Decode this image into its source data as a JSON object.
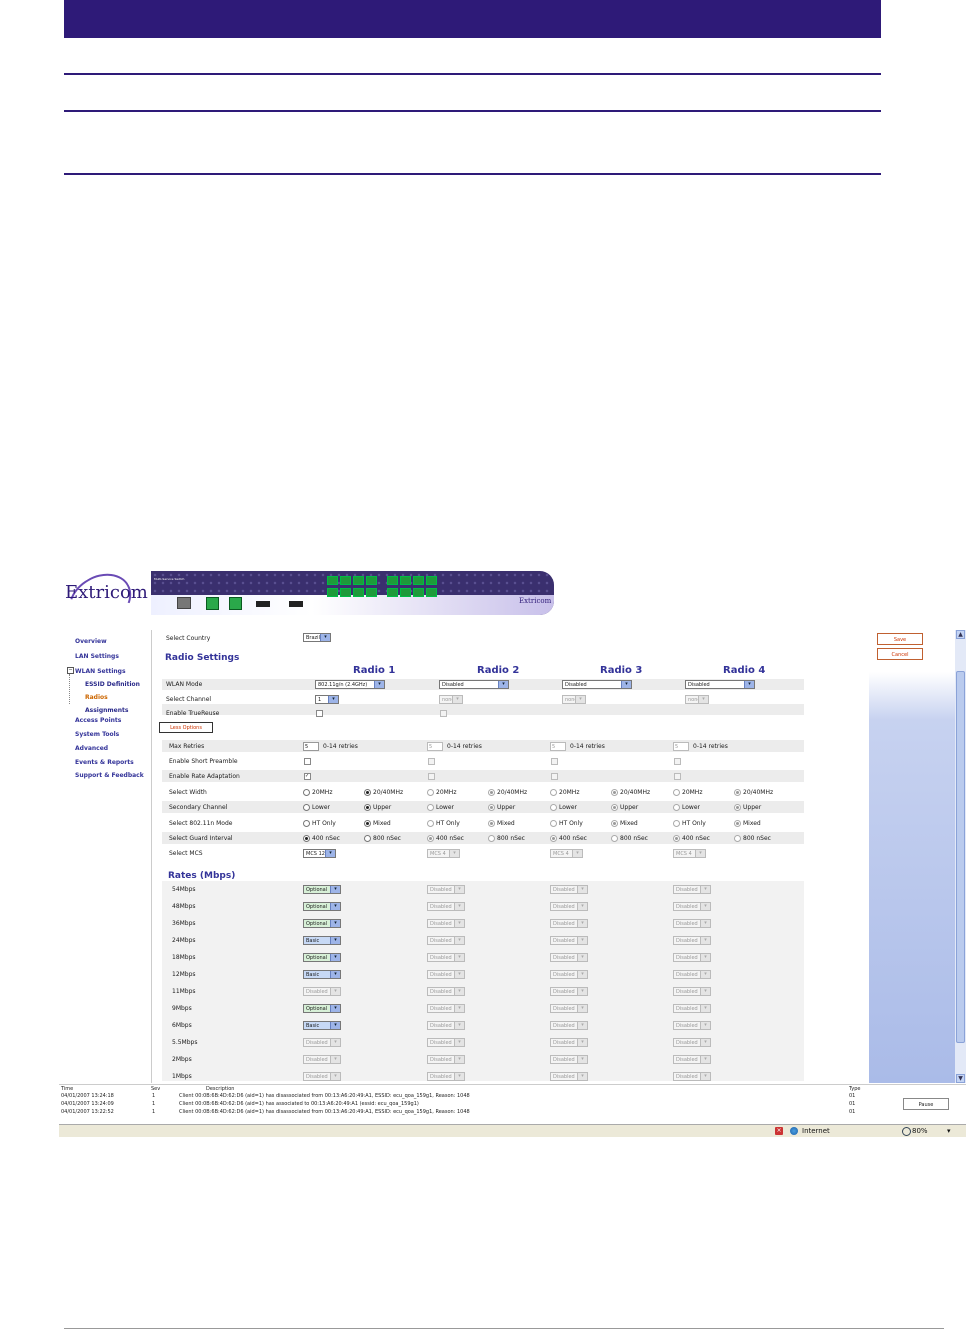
{
  "banner": {},
  "app": {
    "logo": "Extricom",
    "device_logo": "Extricom",
    "device_model_label": "Multi-Service Switch"
  },
  "nav": [
    {
      "label": "Overview"
    },
    {
      "label": "LAN Settings"
    },
    {
      "label": "WLAN Settings"
    },
    {
      "label": "ESSID Definition"
    },
    {
      "label": "Radios"
    },
    {
      "label": "Assignments"
    },
    {
      "label": "Access Points"
    },
    {
      "label": "System Tools"
    },
    {
      "label": "Advanced"
    },
    {
      "label": "Events & Reports"
    },
    {
      "label": "Support & Feedback"
    }
  ],
  "top": {
    "select_country_label": "Select Country",
    "country_value": "Brazil",
    "save": "Save",
    "cancel": "Cancel"
  },
  "radio_settings": {
    "title": "Radio Settings",
    "headers": [
      "Radio 1",
      "Radio 2",
      "Radio 3",
      "Radio 4"
    ],
    "wlan_mode_label": "WLAN Mode",
    "wlan_modes": [
      "802.11g/n (2.4GHz)",
      "Disabled",
      "Disabled",
      "Disabled"
    ],
    "channel_label": "Select Channel",
    "channels": [
      "1",
      "none",
      "none",
      "none"
    ],
    "truereuse_label": "Enable TrueReuse",
    "less_options": "Less Options"
  },
  "advanced": {
    "max_retries_label": "Max Retries",
    "retries": [
      "5",
      "5",
      "5",
      "5"
    ],
    "retries_unit": "0-14 retries",
    "short_preamble_label": "Enable Short Preamble",
    "rate_adaptation_label": "Enable Rate Adaptation",
    "width_label": "Select Width",
    "width_options": [
      "20MHz",
      "20/40MHz"
    ],
    "secondary_label": "Secondary Channel",
    "secondary_options": [
      "Lower",
      "Upper"
    ],
    "n_mode_label": "Select 802.11n Mode",
    "n_mode_options": [
      "HT Only",
      "Mixed"
    ],
    "guard_label": "Select Guard Interval",
    "guard_options": [
      "400 nSec",
      "800 nSec"
    ],
    "mcs_label": "Select MCS",
    "mcs": [
      "MCS 12",
      "MCS 4",
      "MCS 4",
      "MCS 4"
    ]
  },
  "rates": {
    "title": "Rates (Mbps)",
    "rows": [
      {
        "label": "54Mbps",
        "radio1": "Optional",
        "kind": "opt"
      },
      {
        "label": "48Mbps",
        "radio1": "Optional",
        "kind": "opt"
      },
      {
        "label": "36Mbps",
        "radio1": "Optional",
        "kind": "opt"
      },
      {
        "label": "24Mbps",
        "radio1": "Basic",
        "kind": "basic"
      },
      {
        "label": "18Mbps",
        "radio1": "Optional",
        "kind": "opt"
      },
      {
        "label": "12Mbps",
        "radio1": "Basic",
        "kind": "basic"
      },
      {
        "label": "11Mbps",
        "radio1": "Disabled",
        "kind": "dis"
      },
      {
        "label": "9Mbps",
        "radio1": "Optional",
        "kind": "opt"
      },
      {
        "label": "6Mbps",
        "radio1": "Basic",
        "kind": "basic"
      },
      {
        "label": "5.5Mbps",
        "radio1": "Disabled",
        "kind": "dis"
      },
      {
        "label": "2Mbps",
        "radio1": "Disabled",
        "kind": "dis"
      },
      {
        "label": "1Mbps",
        "radio1": "Disabled",
        "kind": "dis"
      }
    ],
    "disabled_label": "Disabled"
  },
  "log": {
    "headers": {
      "time": "Time",
      "sev": "Sev",
      "description": "Description",
      "type": "Type"
    },
    "rows": [
      {
        "time": "04/01/2007 13:24:18",
        "sev": "1",
        "description": "Client 00:0B:6B:4D:62:D6 (aid=1) has disassociated from 00:13:A6:20:49:A1, ESSID: ecu_qoa_159g1, Reason: 1048",
        "type": "01"
      },
      {
        "time": "04/01/2007 13:24:09",
        "sev": "1",
        "description": "Client 00:0B:6B:4D:62:D6 (aid=1) has associated to 00:13:A6:20:49:A1 (essid: ecu_qoa_159g1)",
        "type": "01"
      },
      {
        "time": "04/01/2007 13:22:52",
        "sev": "1",
        "description": "Client 00:0B:6B:4D:62:D6 (aid=1) has disassociated from 00:13:A6:20:49:A1, ESSID: ecu_qoa_159g1, Reason: 1048",
        "type": "01"
      }
    ],
    "pause": "Pause"
  },
  "statusbar": {
    "zone": "Internet",
    "zoom": "80%",
    "zoom_caret": "▾",
    "scroll_up": "▲",
    "scroll_down": "▼"
  },
  "colors": {
    "banner": "#2e1a78",
    "accent_link": "#333399",
    "active_nav": "#cc6600"
  }
}
